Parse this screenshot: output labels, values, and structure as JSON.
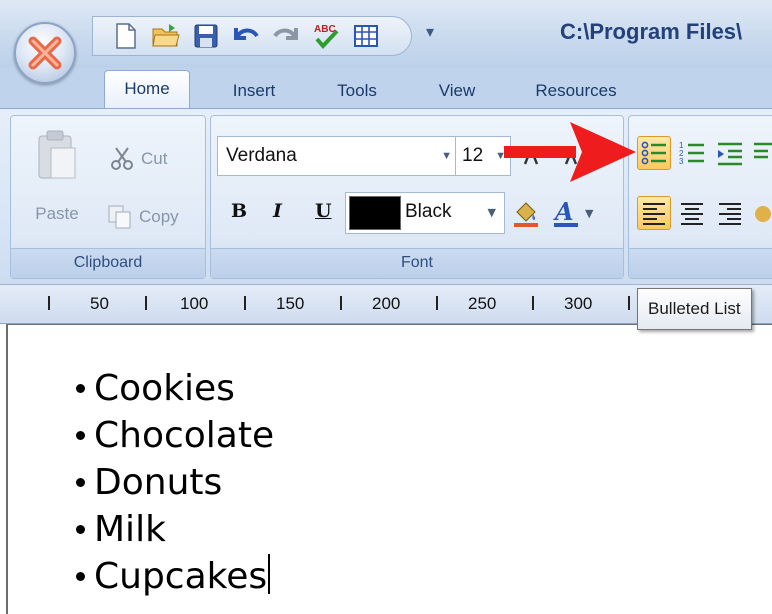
{
  "window": {
    "title": "C:\\Program Files\\",
    "qat_overflow": "▾"
  },
  "qat": {
    "icons": [
      "new-document-icon",
      "open-folder-icon",
      "save-icon",
      "undo-icon",
      "redo-icon",
      "spellcheck-icon",
      "insert-table-icon"
    ]
  },
  "tabs": [
    {
      "label": "Home",
      "active": true
    },
    {
      "label": "Insert"
    },
    {
      "label": "Tools"
    },
    {
      "label": "View"
    },
    {
      "label": "Resources"
    }
  ],
  "clipboard": {
    "paste": "Paste",
    "cut": "Cut",
    "copy": "Copy",
    "group_label": "Clipboard"
  },
  "font": {
    "family": "Verdana",
    "size": "12",
    "bold": "B",
    "italic": "I",
    "underline": "U",
    "color_name": "Black",
    "color_value": "#000000",
    "group_label": "Font"
  },
  "ruler": {
    "labels": [
      "50",
      "100",
      "150",
      "200",
      "250",
      "300"
    ]
  },
  "tooltip": {
    "text": "Bulleted List"
  },
  "document": {
    "items": [
      "Cookies",
      "Chocolate",
      "Donuts",
      "Milk",
      "Cupcakes"
    ]
  },
  "colors": {
    "annotation_arrow": "#ee1c1c",
    "selected_button": "#ffc95e"
  }
}
